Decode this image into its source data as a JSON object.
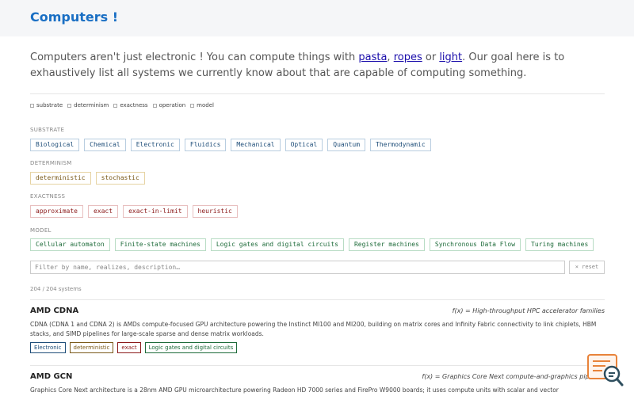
{
  "header": {
    "title": "Computers !"
  },
  "intro": {
    "text_before": "Computers aren't just electronic ! You can compute things with ",
    "link_pasta": "pasta",
    "comma": ", ",
    "link_ropes": "ropes",
    "or_text": " or ",
    "link_light": "light",
    "text_after": ". Our goal here is to exhaustively list all systems we currently know about that are capable of computing something."
  },
  "legend": [
    "substrate",
    "determinism",
    "exactness",
    "operation",
    "model"
  ],
  "groups": {
    "substrate": {
      "label": "SUBSTRATE",
      "items": [
        "Biological",
        "Chemical",
        "Electronic",
        "Fluidics",
        "Mechanical",
        "Optical",
        "Quantum",
        "Thermodynamic"
      ]
    },
    "determinism": {
      "label": "DETERMINISM",
      "items": [
        "deterministic",
        "stochastic"
      ]
    },
    "exactness": {
      "label": "EXACTNESS",
      "items": [
        "approximate",
        "exact",
        "exact-in-limit",
        "heuristic"
      ]
    },
    "model": {
      "label": "MODEL",
      "items": [
        "Cellular automaton",
        "Finite-state machines",
        "Logic gates and digital circuits",
        "Register machines",
        "Synchronous Data Flow",
        "Turing machines"
      ]
    }
  },
  "filter": {
    "placeholder": "Filter by name, realizes, description…",
    "value": "",
    "reset_label": "× reset"
  },
  "count": "204 / 204 systems",
  "entries": [
    {
      "name": "AMD CDNA",
      "fx": "f(x) = High-throughput HPC accelerator families",
      "desc": "CDNA (CDNA 1 and CDNA 2) is AMDs compute-focused GPU architecture powering the Instinct MI100 and MI200, building on matrix cores and Infinity Fabric connectivity to link chiplets, HBM stacks, and SIMD pipelines for large-scale sparse and dense matrix workloads.",
      "tags": [
        "Electronic",
        "deterministic",
        "exact",
        "Logic gates and digital circuits"
      ]
    },
    {
      "name": "AMD GCN",
      "fx": "f(x) = Graphics Core Next compute-and-graphics pipeline",
      "desc": "Graphics Core Next architecture is a 28nm AMD GPU microarchitecture powering Radeon HD 7000 series and FirePro W9000 boards; it uses compute units with scalar and vector"
    }
  ],
  "colors": {
    "title": "#1a6fc4",
    "substrate": "#1f4e79",
    "determinism": "#7a5a1a",
    "exactness": "#8b1a1a",
    "model": "#1e6b3a",
    "badge": "#e8833a"
  },
  "icons": {
    "corner": "search-magnifier-badge-icon"
  }
}
